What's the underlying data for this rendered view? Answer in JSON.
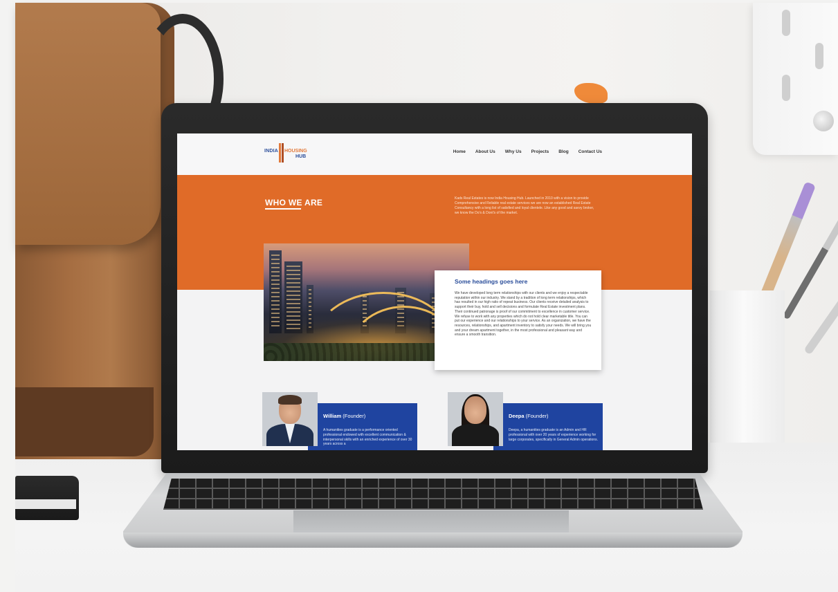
{
  "site": {
    "logo": {
      "word1": "INDIA",
      "word2": "HOUSING",
      "word3": "HUB"
    },
    "nav": [
      "Home",
      "About Us",
      "Why Us",
      "Projects",
      "Blog",
      "Contact Us"
    ]
  },
  "hero": {
    "title": "WHO WE ARE",
    "intro": "Kads Real Estates is now India Housing Hub. Launched in 2010 with a vision to provide Comprehensive and Reliable real estate services we are now an established Real Estate Consultancy with a long list of satisfied and loyal clientele. Like any good and savvy broker, we know the Do's & Dont's of the market."
  },
  "card": {
    "heading": "Some headings goes here",
    "body": "We have developed long term relationships with our clients and we enjoy a respectable reputation within our industry. We stand by a tradition of long term relationships, which has resulted in our high ratio of repeat business. Our clients receive detailed analysis to support their buy, hold and sell decisions and formulate Real Estate investment plans. Their continued patronage is proof of our commitment to excellence in customer service. We refuse to work with any properties which do not hold clear marketable title. You can put our experience and our relationships to your service. As an organization, we have the resources, relationships, and apartment inventory to satisfy your needs. We will bring you and your dream apartment together, in the most professional and pleasant way and ensure a smooth transition."
  },
  "team": [
    {
      "name": "William",
      "role": "(Founder)",
      "bio": "A humanities graduate is a performance oriented professional endowed with excellent communication & interpersonal skills with an enriched experience of over 30 years across a"
    },
    {
      "name": "Deepa",
      "role": "(Founder)",
      "bio": "Deepa, a humanities graduate is an Admin and HR professional with over 20 years of experience working for large corporates, specifically in General Admin operations."
    }
  ],
  "colors": {
    "accent_orange": "#e06b28",
    "brand_blue": "#1f44a0",
    "heading_blue": "#2a4d9a"
  }
}
